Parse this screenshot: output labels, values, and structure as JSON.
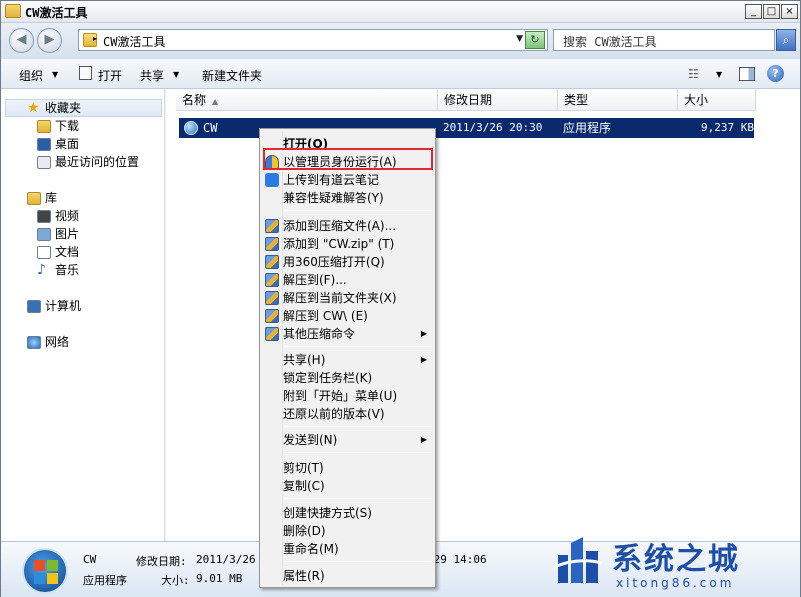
{
  "window": {
    "title": "CW激活工具"
  },
  "address": {
    "path": "CW激活工具",
    "search_placeholder": "搜索 CW激活工具"
  },
  "toolbar": {
    "organize": "组织",
    "open": "打开",
    "share": "共享",
    "new_folder": "新建文件夹"
  },
  "nav": {
    "favorites": "收藏夹",
    "downloads": "下载",
    "desktop": "桌面",
    "recent": "最近访问的位置",
    "libraries": "库",
    "videos": "视频",
    "pictures": "图片",
    "documents": "文档",
    "music": "音乐",
    "computer": "计算机",
    "network": "网络"
  },
  "columns": {
    "name": "名称",
    "date": "修改日期",
    "type": "类型",
    "size": "大小"
  },
  "file": {
    "name": "CW",
    "date": "2011/3/26 20:30",
    "type": "应用程序",
    "size": "9,237 KB"
  },
  "details": {
    "name": "CW",
    "modified_label": "修改日期:",
    "modified_value": "2011/3/26 2",
    "created_tail": "729 14:06",
    "type": "应用程序",
    "size_label": "大小:",
    "size_value": "9.01 MB"
  },
  "context_menu": {
    "open": "打开(O)",
    "run_as_admin": "以管理员身份运行(A)",
    "youdao": "上传到有道云笔记",
    "compat": "兼容性疑难解答(Y)",
    "add_archive": "添加到压缩文件(A)...",
    "add_zip": "添加到 \"CW.zip\" (T)",
    "open_360": "用360压缩打开(Q)",
    "extract_to": "解压到(F)...",
    "extract_here": "解压到当前文件夹(X)",
    "extract_cw": "解压到 CW\\ (E)",
    "other_zip": "其他压缩命令",
    "share": "共享(H)",
    "pin_taskbar": "锁定到任务栏(K)",
    "pin_start": "附到「开始」菜单(U)",
    "restore": "还原以前的版本(V)",
    "send_to": "发送到(N)",
    "cut": "剪切(T)",
    "copy": "复制(C)",
    "create_shortcut": "创建快捷方式(S)",
    "delete": "删除(D)",
    "rename": "重命名(M)",
    "properties": "属性(R)"
  },
  "watermark": {
    "title": "系统之城",
    "url": "xitong86.com"
  },
  "colors": {
    "selection": "#0b2a6e",
    "highlight_border": "#e0282e",
    "brand": "#1d4fa8"
  }
}
